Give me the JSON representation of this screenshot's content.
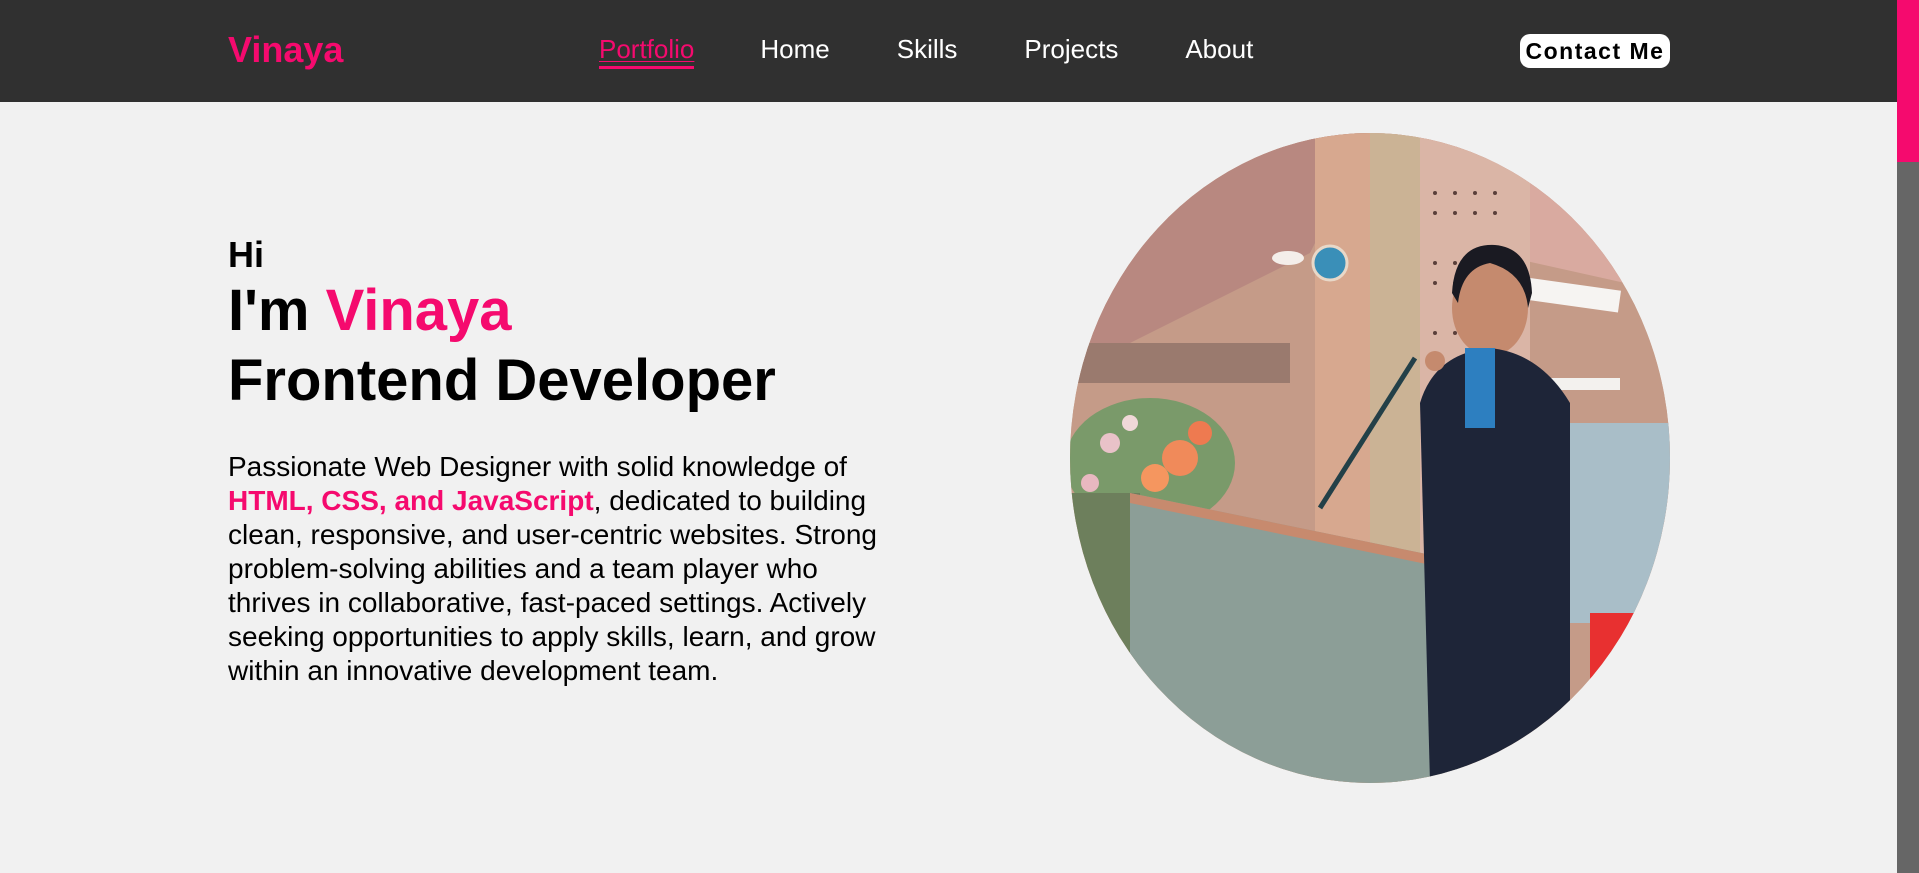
{
  "header": {
    "logo": "Vinaya",
    "nav": [
      {
        "label": "Portfolio",
        "active": true
      },
      {
        "label": "Home",
        "active": false
      },
      {
        "label": "Skills",
        "active": false
      },
      {
        "label": "Projects",
        "active": false
      },
      {
        "label": "About",
        "active": false
      }
    ],
    "contact_label": "Contact Me"
  },
  "hero": {
    "greeting": "Hi",
    "intro_prefix": "I'm ",
    "name": "Vinaya",
    "role": "Frontend Developer",
    "bio_start": "Passionate Web Designer with solid knowledge of ",
    "bio_highlight": "HTML, CSS, and JavaScript",
    "bio_end": ", dedicated to building clean, responsive, and user-centric websites. Strong problem-solving abilities and a team player who thrives in collaborative, fast-paced settings. Actively seeking opportunities to apply skills, learn, and grow within an innovative development team."
  },
  "colors": {
    "accent": "#f50a6e",
    "header_bg": "#303030",
    "page_bg": "#f1f1f1",
    "scroll_track": "#666666"
  },
  "icons": {
    "portrait": "profile-photo"
  }
}
